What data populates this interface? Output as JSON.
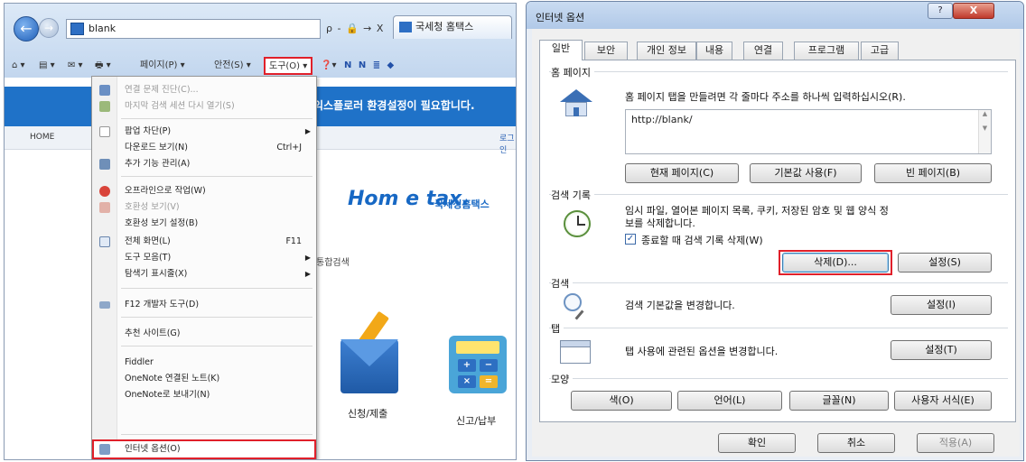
{
  "browser": {
    "address_value": "blank",
    "address_tools": "ρ - 🔒 → X",
    "tab_label": "국세청 홈택스",
    "commandbar": {
      "home": "⌂ ▾",
      "feeds": "▤ ▾",
      "mail": "✉ ▾",
      "print": "🖶 ▾",
      "page": "페이지(P) ▾",
      "safety": "안전(S) ▾",
      "tools": "도구(O) ▾",
      "help": "❓▾",
      "extra": "N N ≣ ◆"
    },
    "content": {
      "banner_text": "익스플로러 환경설정이 필요합니다.",
      "home_label": "HOME",
      "login_label": "로그인",
      "logo_text": "Hom e tax.",
      "logo_sub": "국세청홈택스",
      "search_label": "통합검색",
      "tile1_label": "신청/제출",
      "tile2_label": "신고/납부"
    },
    "tools_menu": [
      {
        "label": "연결 문제 진단(C)...",
        "disabled": true
      },
      {
        "label": "마지막 검색 세션 다시 열기(S)",
        "disabled": true
      },
      {
        "label": "팝업 차단(P)",
        "arrow": true
      },
      {
        "label": "다운로드 보기(N)",
        "shortcut": "Ctrl+J"
      },
      {
        "label": "추가 기능 관리(A)"
      },
      {
        "label": "오프라인으로 작업(W)"
      },
      {
        "label": "호환성 보기(V)",
        "disabled": true
      },
      {
        "label": "호환성 보기 설정(B)"
      },
      {
        "label": "전체 화면(L)",
        "shortcut": "F11"
      },
      {
        "label": "도구 모음(T)",
        "arrow": true
      },
      {
        "label": "탐색기 표시줄(X)",
        "arrow": true
      },
      {
        "label": "F12 개발자 도구(D)"
      },
      {
        "label": "추천 사이트(G)"
      },
      {
        "label": "Fiddler"
      },
      {
        "label": "OneNote 연결된 노트(K)"
      },
      {
        "label": "OneNote로 보내기(N)"
      },
      {
        "label": "인터넷 옵션(O)",
        "highlighted": true
      }
    ]
  },
  "dialog": {
    "title": "인터넷 옵션",
    "help_btn": "?",
    "close_btn": "X",
    "tabs": [
      "일반",
      "보안",
      "개인 정보",
      "내용",
      "연결",
      "프로그램",
      "고급"
    ],
    "home": {
      "title": "홈 페이지",
      "desc": "홈 페이지 탭을 만들려면 각 줄마다 주소를 하나씩 입력하십시오(R).",
      "url": "http://blank/",
      "btn_current": "현재 페이지(C)",
      "btn_default": "기본값 사용(F)",
      "btn_blank": "빈 페이지(B)"
    },
    "history": {
      "title": "검색 기록",
      "desc_line1": "임시 파일, 열어본 페이지 목록, 쿠키, 저장된 암호 및 웹 양식 정",
      "desc_line2": "보를 삭제합니다.",
      "checkbox_label": "종료할 때 검색 기록 삭제(W)",
      "checkbox_checked": true,
      "btn_delete": "삭제(D)...",
      "btn_settings": "설정(S)"
    },
    "search": {
      "title": "검색",
      "desc": "검색 기본값을 변경합니다.",
      "btn_settings": "설정(I)"
    },
    "tabs_section": {
      "title": "탭",
      "desc": "탭 사용에 관련된 옵션을 변경합니다.",
      "btn_settings": "설정(T)"
    },
    "appearance": {
      "title": "모양",
      "btn_colors": "색(O)",
      "btn_languages": "언어(L)",
      "btn_fonts": "글꼴(N)",
      "btn_accessibility": "사용자 서식(E)"
    },
    "footer": {
      "ok": "확인",
      "cancel": "취소",
      "apply": "적용(A)"
    }
  },
  "colors": {
    "highlight": "#e0202a",
    "ie_blue": "#1f72c8",
    "dialog_frame": "#6f86a6"
  }
}
